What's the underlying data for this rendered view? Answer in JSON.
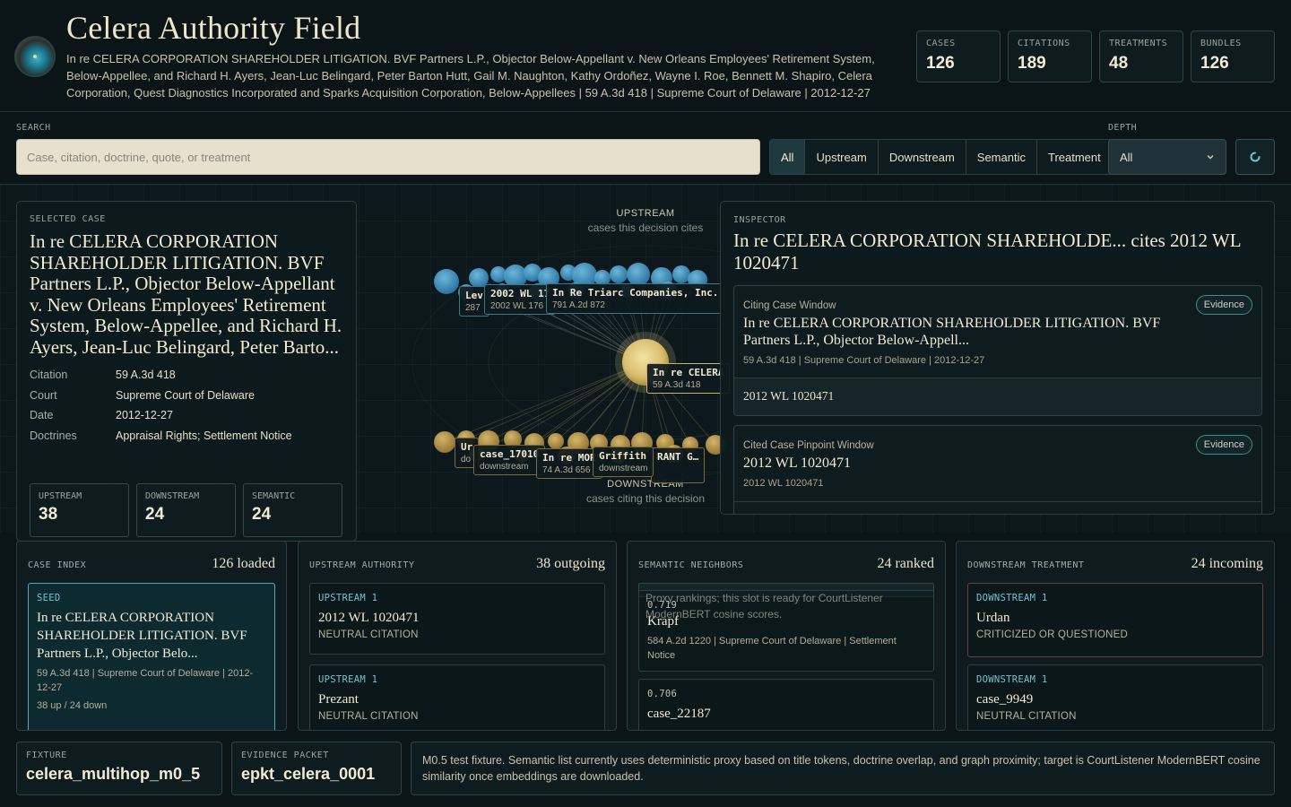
{
  "header": {
    "title": "Celera Authority Field",
    "subtitle": "In re CELERA CORPORATION SHAREHOLDER LITIGATION. BVF Partners L.P., Objector Below-Appellant v. New Orleans Employees' Retirement System, Below-Appellee, and Richard H. Ayers, Jean-Luc Belingard, Peter Barton Hutt, Gail M. Naughton, Kathy Ordoñez, Wayne I. Roe, Bennett M. Shapiro, Celera Corporation, Quest Diagnostics Incorporated and Sparks Acquisition Corporation, Below-Appellees | 59 A.3d 418 | Supreme Court of Delaware | 2012-12-27",
    "stats": [
      {
        "label": "CASES",
        "value": "126"
      },
      {
        "label": "CITATIONS",
        "value": "189"
      },
      {
        "label": "TREATMENTS",
        "value": "48"
      },
      {
        "label": "BUNDLES",
        "value": "126"
      }
    ]
  },
  "search": {
    "label": "SEARCH",
    "placeholder": "Case, citation, doctrine, quote, or treatment",
    "value": ""
  },
  "filters": {
    "items": [
      "All",
      "Upstream",
      "Downstream",
      "Semantic",
      "Treatment"
    ],
    "active": "All"
  },
  "depth": {
    "label": "DEPTH",
    "value": "All"
  },
  "icons": {
    "logo": "orb-logo-icon",
    "refresh": "refresh-icon",
    "select": "chevron-down-icon"
  },
  "colors": {
    "accent": "#6fc5d4",
    "upstream_node": "#4aa8d8",
    "downstream_node": "#d4b060",
    "seed_node": "#e8d08a",
    "evidence": "#3f8f7f"
  },
  "graph": {
    "upstream_caption": "UPSTREAM",
    "upstream_sub": "cases this decision cites",
    "downstream_caption": "DOWNSTREAM",
    "downstream_sub": "cases citing this decision",
    "seed": {
      "name": "In re CELERA",
      "cite": "59 A.3d 418"
    },
    "upstream_labels": [
      {
        "name": "Lev",
        "cite": "287"
      },
      {
        "name": "2002 WL 17",
        "cite": "2002 WL 176"
      },
      {
        "name": "In Re Triarc Companies, Inc.",
        "cite": "791 A.2d 872"
      }
    ],
    "downstream_labels": [
      {
        "name": "Ur",
        "cite": "do"
      },
      {
        "name": "case_17010",
        "cite": "downstream"
      },
      {
        "name": "In re MOR",
        "cite": "74 A.3d 656"
      },
      {
        "name": "Griffith",
        "cite": "downstream"
      },
      {
        "name": "RANT G…",
        "cite": ""
      }
    ]
  },
  "selected": {
    "label": "SELECTED CASE",
    "title": "In re CELERA CORPORATION SHAREHOLDER LITIGATION. BVF Partners L.P., Objector Below-Appellant v. New Orleans Employees' Retirement System, Below-Appellee, and Richard H. Ayers, Jean-Luc Belingard, Peter Barto...",
    "fields": [
      {
        "k": "Citation",
        "v": "59 A.3d 418"
      },
      {
        "k": "Court",
        "v": "Supreme Court of Delaware"
      },
      {
        "k": "Date",
        "v": "2012-12-27"
      },
      {
        "k": "Doctrines",
        "v": "Appraisal Rights; Settlement Notice"
      }
    ],
    "counts": [
      {
        "label": "UPSTREAM",
        "value": "38"
      },
      {
        "label": "DOWNSTREAM",
        "value": "24"
      },
      {
        "label": "SEMANTIC",
        "value": "24"
      }
    ]
  },
  "inspector": {
    "label": "INSPECTOR",
    "title": "In re CELERA CORPORATION SHAREHOLDE... cites 2012 WL 1020471",
    "citing": {
      "caption": "Citing Case Window",
      "title": "In re CELERA CORPORATION SHAREHOLDER LITIGATION. BVF Partners L.P., Objector Below-Appell...",
      "meta": "59 A.3d 418 | Supreme Court of Delaware | 2012-12-27",
      "footer": "2012 WL 1020471",
      "button": "Evidence"
    },
    "cited": {
      "caption": "Cited Case Pinpoint Window",
      "title": "2012 WL 1020471",
      "meta": "2012 WL 1020471",
      "button": "Evidence"
    }
  },
  "case_index": {
    "label": "CASE INDEX",
    "count": "126 loaded",
    "items": [
      {
        "kind": "SEED",
        "title": "In re CELERA CORPORATION SHAREHOLDER LITIGATION. BVF Partners L.P., Objector Belo...",
        "meta": "59 A.3d 418 | Supreme Court of Delaware | 2012-12-27",
        "extra": "38 up / 24 down"
      }
    ]
  },
  "upstream": {
    "label": "UPSTREAM AUTHORITY",
    "count": "38 outgoing",
    "items": [
      {
        "kind": "UPSTREAM 1",
        "title": "2012 WL 1020471",
        "tag": "NEUTRAL CITATION"
      },
      {
        "kind": "UPSTREAM 1",
        "title": "Prezant",
        "tag": "NEUTRAL CITATION"
      }
    ]
  },
  "semantic": {
    "label": "SEMANTIC NEIGHBORS",
    "count": "24 ranked",
    "note": "Proxy rankings; this slot is ready for CourtListener ModernBERT cosine scores.",
    "items": [
      {
        "kind": "0.719",
        "title": "Krapf",
        "meta": "584 A.2d 1220 | Supreme Court of Delaware | Settlement Notice"
      },
      {
        "kind": "0.706",
        "title": "case_22187",
        "meta": ""
      }
    ]
  },
  "downstream": {
    "label": "DOWNSTREAM TREATMENT",
    "count": "24 incoming",
    "items": [
      {
        "kind": "DOWNSTREAM 1",
        "title": "Urdan",
        "tag": "CRITICIZED OR QUESTIONED"
      },
      {
        "kind": "DOWNSTREAM 1",
        "title": "case_9949",
        "tag": "NEUTRAL CITATION"
      }
    ]
  },
  "footer": {
    "fixture_label": "FIXTURE",
    "fixture_value": "celera_multihop_m0_5",
    "packet_label": "EVIDENCE PACKET",
    "packet_value": "epkt_celera_0001",
    "note": "M0.5 test fixture. Semantic list currently uses deterministic proxy based on title tokens, doctrine overlap, and graph proximity; target is CourtListener ModernBERT cosine similarity once embeddings are downloaded."
  }
}
